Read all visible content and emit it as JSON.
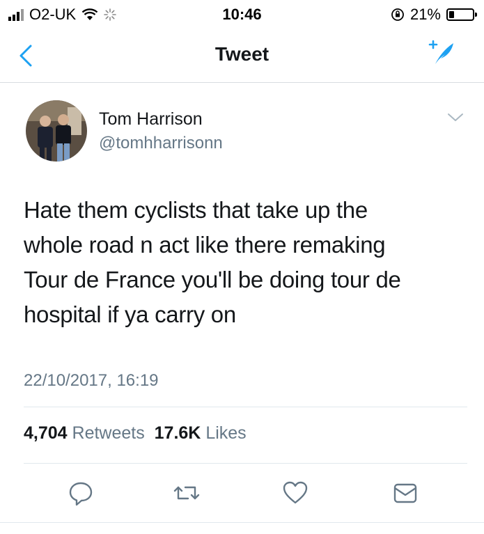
{
  "status_bar": {
    "carrier": "O2-UK",
    "time": "10:46",
    "battery_percent": "21%",
    "battery_level": 0.21
  },
  "nav": {
    "title": "Tweet",
    "back_icon": "chevron-left-icon",
    "compose_icon": "compose-tweet-icon"
  },
  "tweet": {
    "display_name": "Tom Harrison",
    "handle": "@tomhharrisonn",
    "text": "Hate them cyclists that take up the whole road n act like there remaking Tour de France you'll be doing tour de hospital if ya carry on",
    "lines": [
      "Hate them cyclists that take up the",
      "whole road n act like there remaking",
      "Tour de France you'll be doing tour de",
      "hospital if ya carry on"
    ],
    "timestamp": "22/10/2017, 16:19",
    "retweets_count": "4,704",
    "retweets_label": "Retweets",
    "likes_count": "17.6K",
    "likes_label": "Likes"
  },
  "actions": [
    "reply-icon",
    "retweet-icon",
    "like-icon",
    "share-icon"
  ],
  "colors": {
    "accent": "#1da1f2",
    "muted": "#657786",
    "text": "#14171a",
    "divider": "#e1e8ed"
  }
}
